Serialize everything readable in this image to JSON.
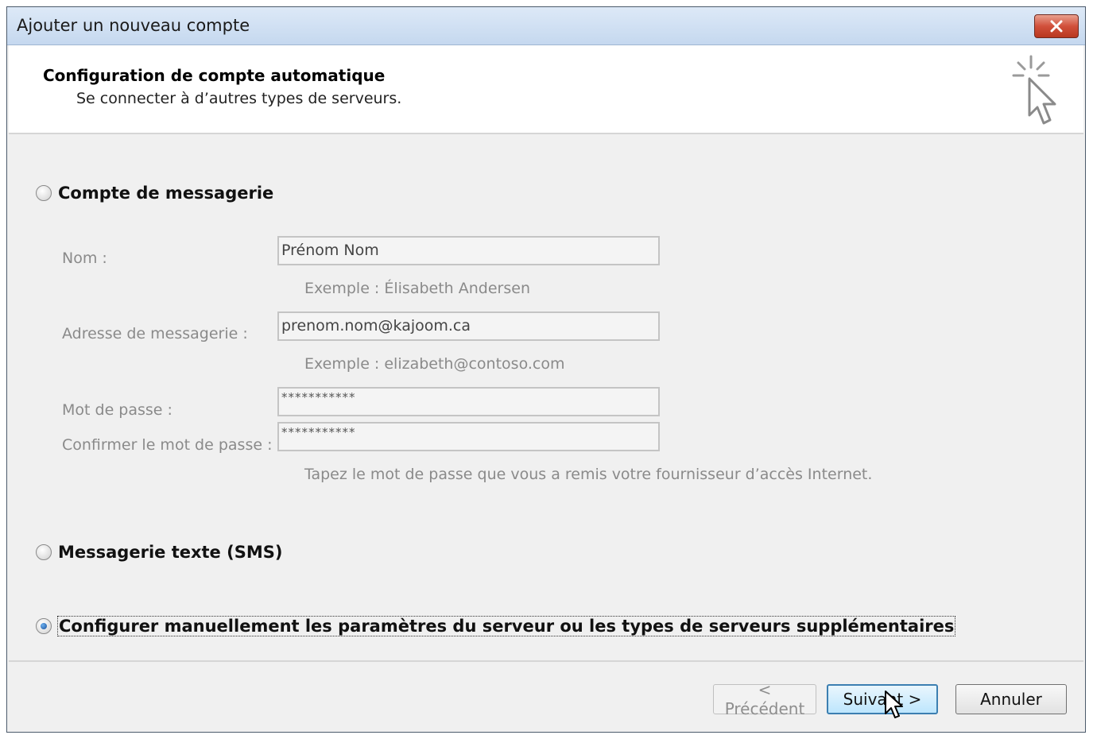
{
  "window": {
    "title": "Ajouter un nouveau compte"
  },
  "header": {
    "title": "Configuration de compte automatique",
    "subtitle": "Se connecter à d’autres types de serveurs."
  },
  "options": {
    "email_account": {
      "label": "Compte de messagerie",
      "selected": false
    },
    "sms": {
      "label": "Messagerie texte (SMS)",
      "selected": false
    },
    "manual": {
      "label": "Configurer manuellement les paramètres du serveur ou les types de serveurs supplémentaires",
      "selected": true
    }
  },
  "form": {
    "name_label": "Nom :",
    "name_value": "Prénom Nom",
    "name_hint": "Exemple : Élisabeth Andersen",
    "email_label": "Adresse de messagerie :",
    "email_value": "prenom.nom@kajoom.ca",
    "email_hint": "Exemple : elizabeth@contoso.com",
    "password_label": "Mot de passe :",
    "password_value": "***********",
    "confirm_label": "Confirmer le mot de passe :",
    "confirm_value": "***********",
    "password_hint": "Tapez le mot de passe que vous a remis votre fournisseur d’accès Internet."
  },
  "buttons": {
    "back": "< Précédent",
    "next": "Suivant >",
    "cancel": "Annuler"
  },
  "icons": {
    "close": "close-icon",
    "wizard": "cursor-sparkle-icon",
    "pointer": "mouse-pointer-icon"
  },
  "colors": {
    "title_bar": "#c5d8ef",
    "close_button": "#d1503b",
    "default_button_border": "#3c7fb1",
    "disabled_text": "#8a8a8a"
  }
}
